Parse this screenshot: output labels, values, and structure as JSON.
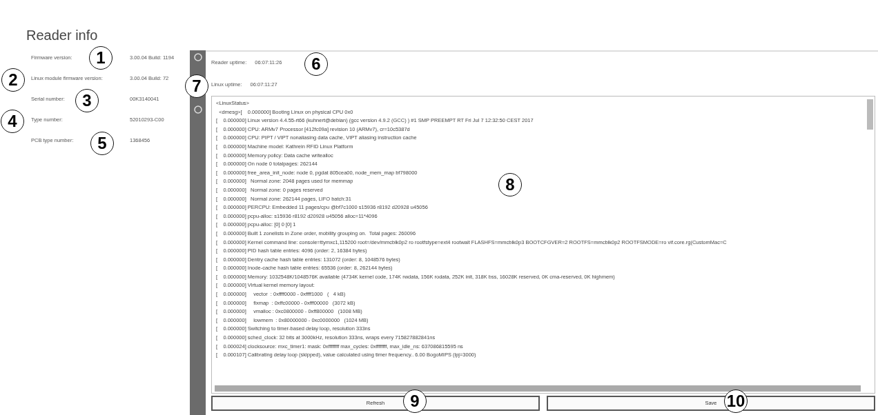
{
  "title": "Reader info",
  "info": [
    {
      "label": "Firmware version:",
      "value": "3.00.04 Build: 1194"
    },
    {
      "label": "Linux module firmware version:",
      "value": "3.00.04 Build: 72"
    },
    {
      "label": "Serial number:",
      "value": "00K3140041"
    },
    {
      "label": "Type number:",
      "value": "52010293-C00"
    },
    {
      "label": "PCB type number:",
      "value": "1368456"
    }
  ],
  "uptimes": [
    {
      "label": "Reader uptime:",
      "value": "06:07:11:26"
    },
    {
      "label": "Linux uptime:",
      "value": "06:07:11:27"
    }
  ],
  "log_lines": [
    "<LinuxStatus>",
    "  <dmesg>[    0.000000] Booting Linux on physical CPU 0x0",
    "[    0.000000] Linux version 4.4.55-rt66 (kuhnert@debian) (gcc version 4.9.2 (GCC) ) #1 SMP PREEMPT RT Fri Jul 7 12:32:50 CEST 2017",
    "[    0.000000] CPU: ARMv7 Processor [412fc09a] revision 10 (ARMv7), cr=10c5387d",
    "[    0.000000] CPU: PIPT / VIPT nonaliasing data cache, VIPT aliasing instruction cache",
    "[    0.000000] Machine model: Kathrein RFID Linux Platform",
    "[    0.000000] Memory policy: Data cache writealloc",
    "[    0.000000] On node 0 totalpages: 262144",
    "[    0.000000] free_area_init_node: node 0, pgdat 805cea00, node_mem_map bf798000",
    "[    0.000000]   Normal zone: 2048 pages used for memmap",
    "[    0.000000]   Normal zone: 0 pages reserved",
    "[    0.000000]   Normal zone: 262144 pages, LIFO batch:31",
    "[    0.000000] PERCPU: Embedded 11 pages/cpu @bf7c1000 s15936 r8192 d20928 u45056",
    "[    0.000000] pcpu-alloc: s15936 r8192 d20928 u45056 alloc=11*4096",
    "[    0.000000] pcpu-alloc: [0] 0 [0] 1",
    "[    0.000000] Built 1 zonelists in Zone order, mobility grouping on.  Total pages: 260096",
    "[    0.000000] Kernel command line: console=ttymxc1,115200 root=/dev/mmcblk0p2 ro rootfstype=ext4 rootwait FLASHFS=mmcblk0p3 BOOTCFGVER=2 ROOTFS=mmcblk0p2 ROOTFSMODE=ro vif.core.rg(CustomMac=C",
    "[    0.000000] PID hash table entries: 4096 (order: 2, 16384 bytes)",
    "[    0.000000] Dentry cache hash table entries: 131072 (order: 8, 1048576 bytes)",
    "[    0.000000] Inode-cache hash table entries: 65536 (order: 8, 262144 bytes)",
    "[    0.000000] Memory: 1032548K/1048576K available (4734K kernel code, 174K rwdata, 156K rodata, 252K init, 318K bss, 16028K reserved, 0K cma-reserved, 0K highmem)",
    "[    0.000000] Virtual kernel memory layout:",
    "[    0.000000]     vector  : 0xffff0000 - 0xffff1000   (   4 kB)",
    "[    0.000000]     fixmap  : 0xffc00000 - 0xfff00000   (3072 kB)",
    "[    0.000000]     vmalloc : 0xc0800000 - 0xff800000   (1008 MB)",
    "[    0.000000]     lowmem  : 0x80000000 - 0xc0000000   (1024 MB)",
    "[    0.000000] Switching to timer-based delay loop, resolution 333ns",
    "[    0.000000] sched_clock: 32 bits at 3000kHz, resolution 333ns, wraps every 715827882841ns",
    "[    0.000024] clocksource: mxc_timer1: mask: 0xffffffff max_cycles: 0xffffffff, max_idle_ns: 637086815595 ns",
    "[    0.000107] Calibrating delay loop (skipped), value calculated using timer frequency.. 6.00 BogoMIPS (lpj=3000)"
  ],
  "buttons": [
    "Refresh",
    "Save"
  ],
  "callouts": [
    "1",
    "2",
    "3",
    "4",
    "5",
    "6",
    "7",
    "8",
    "9",
    "10"
  ]
}
